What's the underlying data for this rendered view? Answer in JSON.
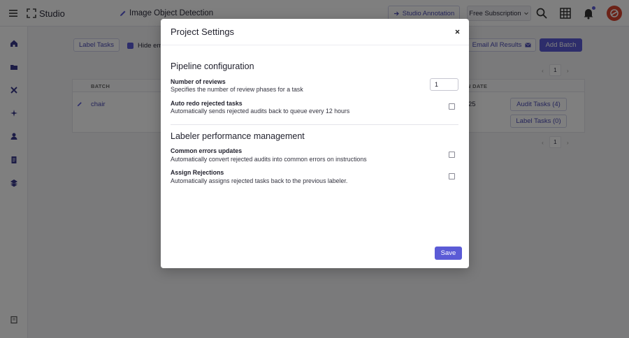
{
  "topbar": {
    "app_name": "Studio",
    "project_name": "Image Object Detection",
    "pin_glyph": "•",
    "annotation_button": "Studio Annotation",
    "subscription_button": "Free Subscription",
    "icons": [
      "menu-icon",
      "studio-logo-icon",
      "pencil-icon",
      "search-icon",
      "apps-grid-icon",
      "bell-icon",
      "avatar"
    ]
  },
  "sidebar": {
    "icons": [
      "home-icon",
      "folder-icon",
      "tools-icon",
      "sparkle-icon",
      "person-icon",
      "document-icon",
      "layers-icon",
      "book-icon"
    ]
  },
  "background": {
    "label_tasks_button": "Label Tasks",
    "hide_empty_label": "Hide em",
    "email_results_button": "Email All Results",
    "add_batch_button": "Add Batch",
    "page_number": "1",
    "table": {
      "col_batch": "BATCH",
      "col_date": "N DATE",
      "row_name": "chair",
      "row_date": "25",
      "audit_button": "Audit Tasks (4)",
      "label_button": "Label Tasks (0)"
    }
  },
  "modal": {
    "title": "Project Settings",
    "sections": [
      {
        "title": "Pipeline configuration",
        "settings": [
          {
            "label": "Number of reviews",
            "description": "Specifies the number of review phases for a task",
            "value": "1"
          },
          {
            "label": "Auto redo rejected tasks",
            "description": "Automatically sends rejected audits back to queue every 12 hours",
            "checked": false
          }
        ]
      },
      {
        "title": "Labeler performance management",
        "settings": [
          {
            "label": "Common errors updates",
            "description": "Automatically convert rejected audits into common errors on instructions",
            "checked": false
          },
          {
            "label": "Assign Rejections",
            "description": "Automatically assigns rejected tasks back to the previous labeler.",
            "checked": false
          }
        ]
      }
    ],
    "save_button": "Save"
  },
  "colors": {
    "accent": "#5b5bd6",
    "overlay": "rgba(0,0,0,0.5)",
    "avatar": "#d8442e"
  }
}
